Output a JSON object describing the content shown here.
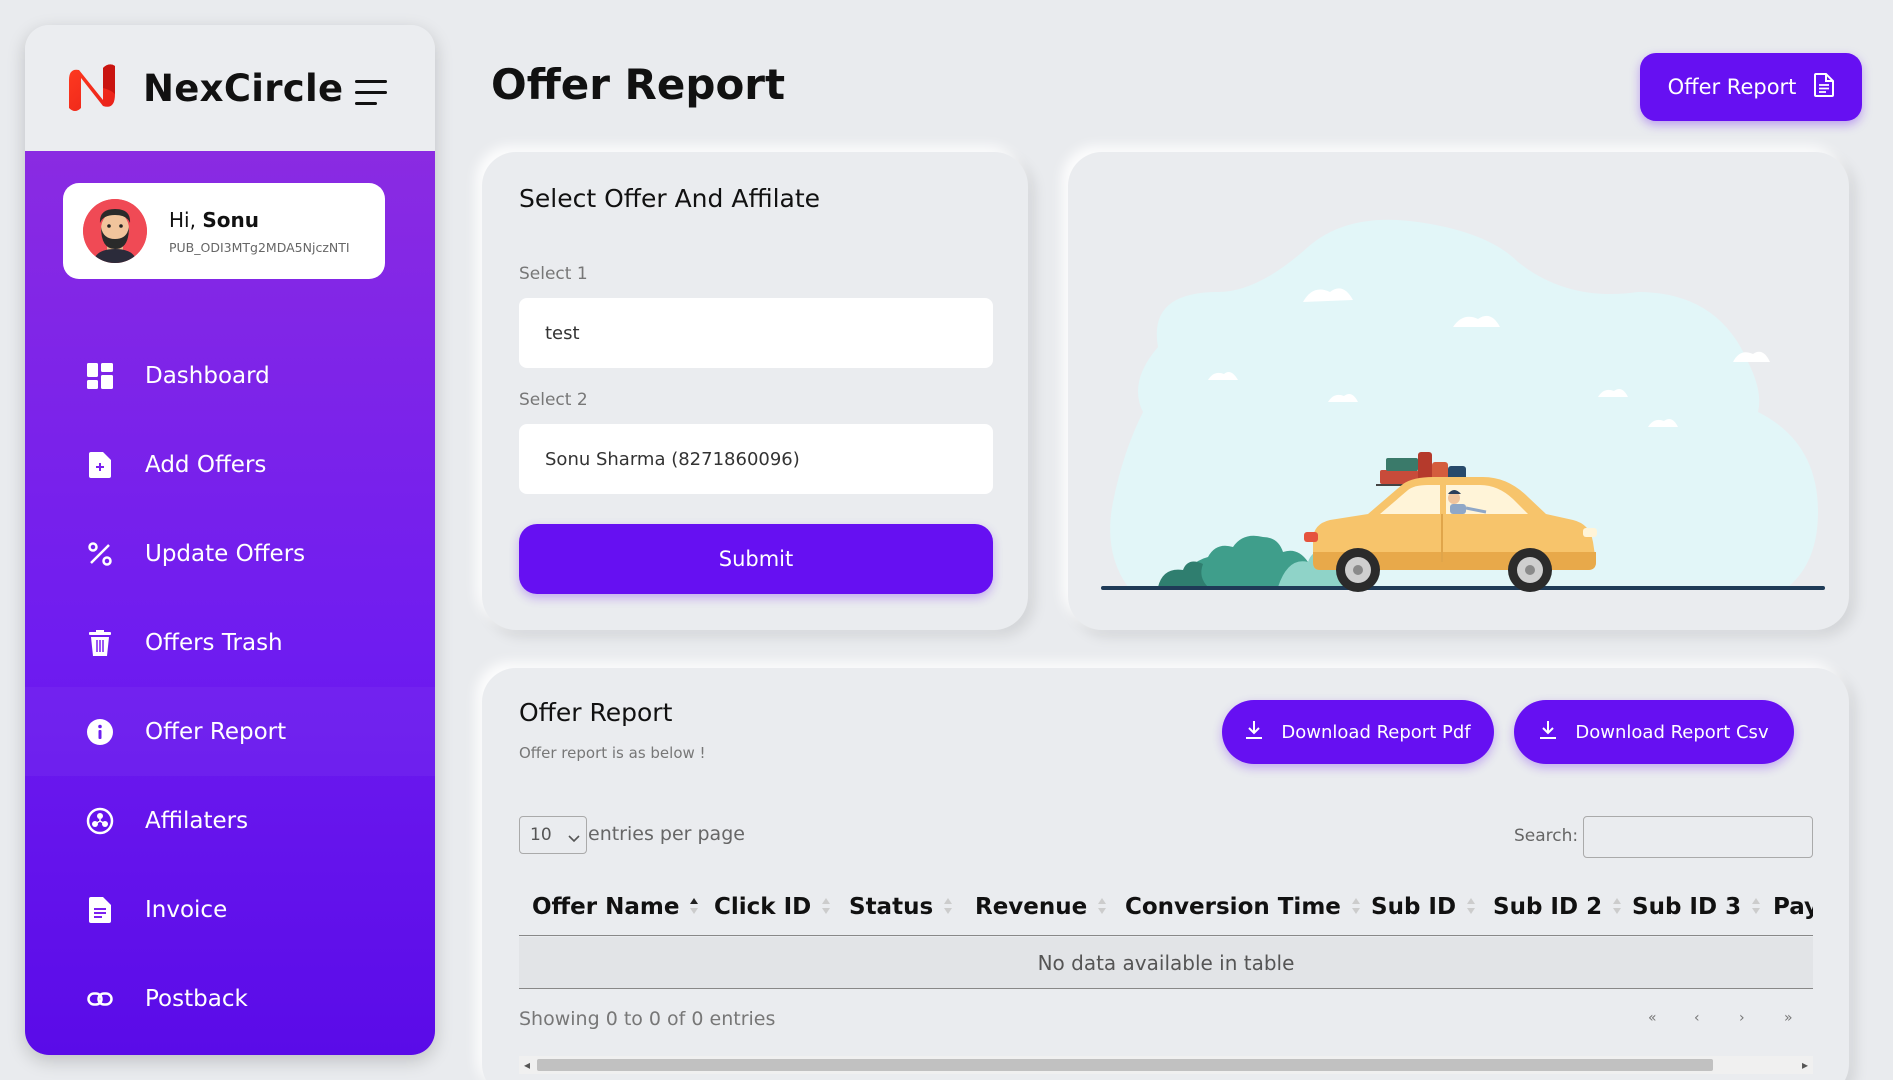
{
  "brand": {
    "name": "NexCircle"
  },
  "user": {
    "greeting": "Hi,",
    "name": "Sonu",
    "id": "PUB_ODI3MTg2MDA5NjczNTI"
  },
  "menu": [
    {
      "label": "Dashboard",
      "icon": "dashboard-icon"
    },
    {
      "label": "Add Offers",
      "icon": "add-document-icon"
    },
    {
      "label": "Update Offers",
      "icon": "percent-icon"
    },
    {
      "label": "Offers Trash",
      "icon": "trash-icon"
    },
    {
      "label": "Offer Report",
      "icon": "info-icon"
    },
    {
      "label": "Affilaters",
      "icon": "network-icon"
    },
    {
      "label": "Invoice",
      "icon": "invoice-icon"
    },
    {
      "label": "Postback",
      "icon": "link-icon"
    }
  ],
  "header": {
    "title": "Offer Report",
    "button_label": "Offer Report"
  },
  "form": {
    "title": "Select Offer And Affilate",
    "select1_label": "Select 1",
    "select1_value": "test",
    "select2_label": "Select 2",
    "select2_value": "Sonu Sharma (8271860096)",
    "submit_label": "Submit"
  },
  "report": {
    "title": "Offer Report",
    "subtitle": "Offer report is as below !",
    "download_pdf": "Download Report Pdf",
    "download_csv": "Download Report Csv",
    "entries_value": "10",
    "entries_label": "entries per page",
    "search_label": "Search:",
    "columns": [
      "Offer Name",
      "Click ID",
      "Status",
      "Revenue",
      "Conversion Time",
      "Sub ID",
      "Sub ID 2",
      "Sub ID 3",
      "Pay"
    ],
    "empty_text": "No data available in table",
    "showing_text": "Showing 0 to 0 of 0 entries",
    "pager": [
      "«",
      "‹",
      "›",
      "»"
    ]
  },
  "colors": {
    "accent": "#6610f2",
    "sidebar_top": "#8a2be2",
    "sidebar_bottom": "#5a0be8",
    "background": "#e9ebee"
  }
}
